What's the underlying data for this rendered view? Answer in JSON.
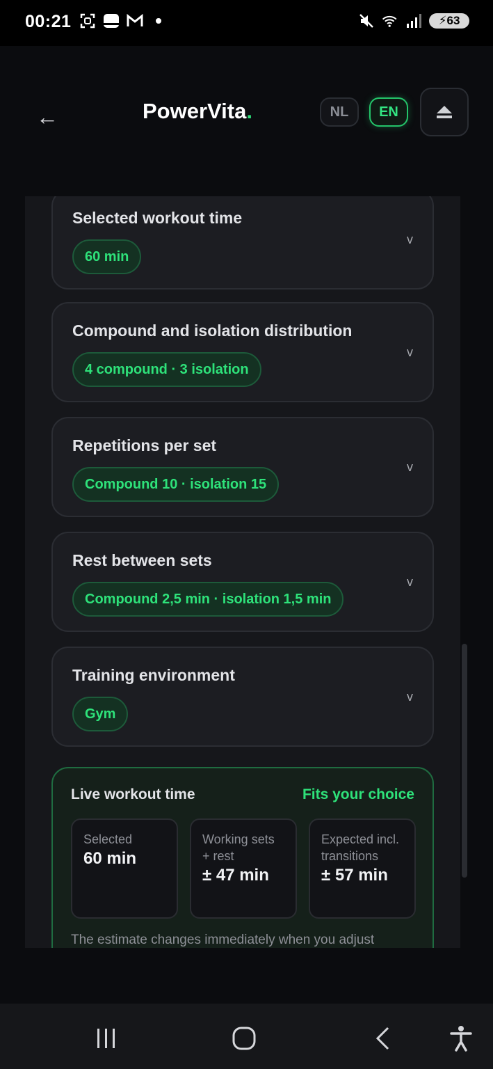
{
  "status_bar": {
    "time": "00:21",
    "battery": "63",
    "icons_left": [
      "screenshot-icon",
      "app-icon",
      "gmail-icon",
      "dot-icon"
    ],
    "icons_right": [
      "mute-icon",
      "wifi-icon",
      "signal-icon",
      "battery-icon"
    ]
  },
  "header": {
    "back_label": "←",
    "brand": "PowerVita",
    "brand_dot": ".",
    "lang_nl": "NL",
    "lang_en": "EN",
    "active_lang": "EN"
  },
  "cards": [
    {
      "title": "Selected workout time",
      "value": "60 min"
    },
    {
      "title": "Compound and isolation distribution",
      "value": "4 compound · 3 isolation"
    },
    {
      "title": "Repetitions per set",
      "value": "Compound 10 · isolation 15"
    },
    {
      "title": "Rest between sets",
      "value": "Compound 2,5 min · isolation 1,5 min"
    },
    {
      "title": "Training environment",
      "value": "Gym"
    }
  ],
  "chevron": "v",
  "live": {
    "title": "Live workout time",
    "badge": "Fits your choice",
    "stats": [
      {
        "label": "Selected",
        "value": "60 min"
      },
      {
        "label": "Working sets + rest",
        "value": "± 47 min"
      },
      {
        "label": "Expected incl. transitions",
        "value": "± 57 min"
      }
    ],
    "note": "The estimate changes immediately when you adjust"
  },
  "colors": {
    "accent": "#2ee27a",
    "background": "#0b0c0f",
    "card": "#1c1d22"
  }
}
